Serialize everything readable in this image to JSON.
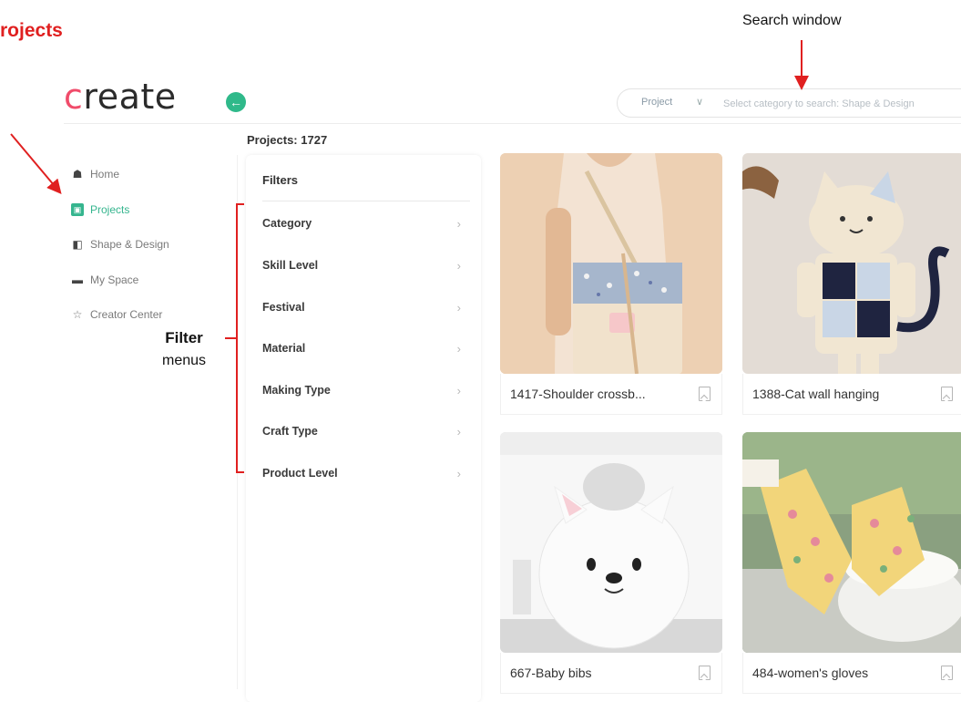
{
  "annotations": {
    "page_title": "rojects",
    "search_label": "Search window",
    "filter_label_bold": "Filter",
    "filter_label_rest": "menus"
  },
  "app": {
    "logo_text": "create",
    "back_icon": "arrow-left-icon"
  },
  "search": {
    "category": "Project",
    "placeholder": "Select category to search: Shape & Design"
  },
  "sidebar": {
    "items": [
      {
        "label": "Home",
        "icon": "home-icon"
      },
      {
        "label": "Projects",
        "icon": "projects-icon",
        "active": true
      },
      {
        "label": "Shape & Design",
        "icon": "shape-design-icon"
      },
      {
        "label": "My Space",
        "icon": "folder-icon"
      },
      {
        "label": "Creator Center",
        "icon": "star-icon"
      }
    ]
  },
  "projects": {
    "count_label": "Projects:",
    "count": "1727"
  },
  "filters": {
    "title": "Filters",
    "items": [
      "Category",
      "Skill Level",
      "Festival",
      "Material",
      "Making Type",
      "Craft Type",
      "Product Level"
    ]
  },
  "cards": [
    {
      "title": "1417-Shoulder crossb...",
      "image": "shoulder-bag-photo"
    },
    {
      "title": "1388-Cat wall hanging",
      "image": "cat-wall-hanging-photo"
    },
    {
      "title": "667-Baby bibs",
      "image": "baby-bib-photo"
    },
    {
      "title": "484-women's gloves",
      "image": "oven-gloves-photo"
    }
  ],
  "colors": {
    "accent_green": "#35b58e",
    "annotation_red": "#e02020"
  }
}
